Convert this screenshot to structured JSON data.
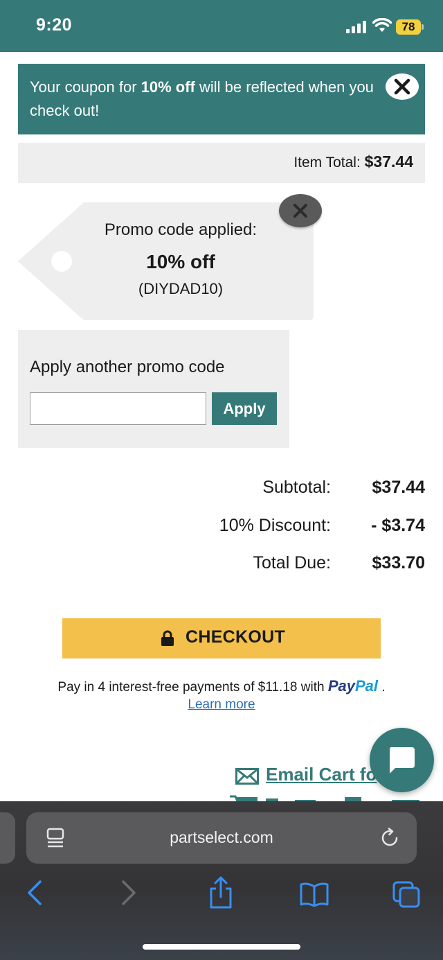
{
  "status_bar": {
    "time": "9:20",
    "battery": "78",
    "background_color": "#357a78"
  },
  "coupon_banner": {
    "text_before": "Your coupon for ",
    "text_bold": "10% off",
    "text_after": " will be reflected when you check out!",
    "close_icon": "close-icon"
  },
  "item_total": {
    "label": "Item Total: ",
    "amount": "$37.44"
  },
  "promo_tag": {
    "applied_label": "Promo code applied:",
    "discount": "10% off",
    "code": "(DIYDAD10)",
    "remove_icon": "close-icon"
  },
  "promo_form": {
    "label": "Apply another promo code",
    "input_value": "",
    "apply_label": "Apply"
  },
  "totals": [
    {
      "label": "Subtotal:",
      "value": "$37.44"
    },
    {
      "label": "10% Discount:",
      "value": "- $3.74"
    },
    {
      "label": "Total Due:",
      "value": "$33.70"
    }
  ],
  "checkout": {
    "label": "CHECKOUT",
    "icon": "lock-icon",
    "color": "#f3c04c"
  },
  "paypal": {
    "text": "Pay in 4 interest-free payments of $11.18 with ",
    "logo_pay": "Pay",
    "logo_pal": "Pal",
    "suffix": " .",
    "learn_more": "Learn more"
  },
  "email_cart": {
    "label": "Email Cart fo",
    "icon": "envelope-icon"
  },
  "chat": {
    "icon": "chat-bubble-icon"
  },
  "browser": {
    "url": "partselect.com",
    "buttons": [
      "back-icon",
      "forward-icon",
      "share-icon",
      "bookmarks-icon",
      "tabs-icon"
    ]
  },
  "colors": {
    "brand_teal": "#357a78",
    "panel_gray": "#eeeeee",
    "checkout_yellow": "#f3c04c"
  }
}
